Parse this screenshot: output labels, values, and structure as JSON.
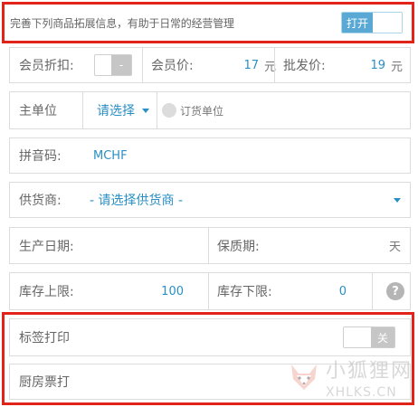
{
  "banner": {
    "text": "完善下列商品拓展信息，有助于日常的经营管理",
    "toggle_label": "打开"
  },
  "member_row": {
    "discount_label": "会员折扣:",
    "discount_toggle": "-",
    "member_price_label": "会员价:",
    "member_price_value": "17",
    "member_price_unit": "元",
    "wholesale_label": "批发价:",
    "wholesale_value": "19",
    "wholesale_unit": "元"
  },
  "unit_row": {
    "label": "主单位",
    "select_text": "请选择",
    "order_unit_label": "订货单位"
  },
  "pinyin_row": {
    "label": "拼音码:",
    "value": "MCHF"
  },
  "supplier_row": {
    "label": "供货商:",
    "value": "- 请选择供货商 -"
  },
  "date_row": {
    "production_label": "生产日期:",
    "shelf_label": "保质期:",
    "shelf_unit": "天"
  },
  "stock_row": {
    "upper_label": "库存上限:",
    "upper_value": "100",
    "lower_label": "库存下限:",
    "lower_value": "0",
    "help_glyph": "?"
  },
  "label_print_row": {
    "label": "标签打印",
    "toggle_label": "关"
  },
  "kitchen_row": {
    "label": "厨房票打"
  },
  "watermark": {
    "cn": "小狐狸网",
    "en": "XHLKS.CN"
  },
  "colors": {
    "accent": "#2a8fc4",
    "highlight_border": "#e2231a",
    "toggle_on": "#5aa9d4"
  }
}
